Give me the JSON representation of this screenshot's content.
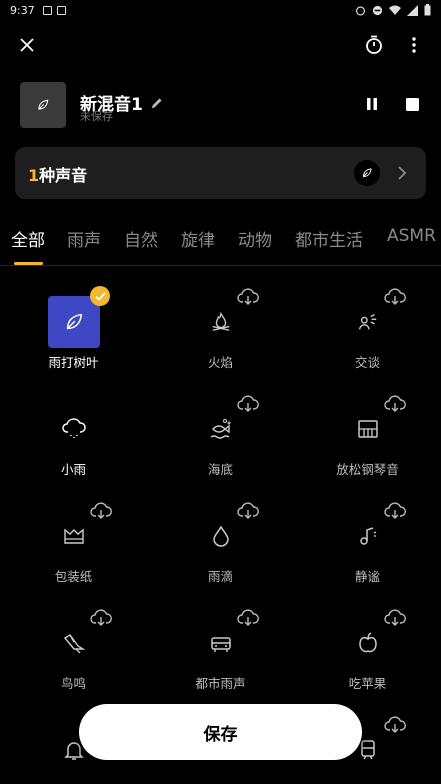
{
  "status_bar": {
    "time": "9:37"
  },
  "mix": {
    "title": "新混音1",
    "subtitle": "未保存"
  },
  "sound_count": {
    "number": "1",
    "suffix": "种声音"
  },
  "tabs": [
    {
      "label": "全部",
      "active": true
    },
    {
      "label": "雨声"
    },
    {
      "label": "自然"
    },
    {
      "label": "旋律"
    },
    {
      "label": "动物"
    },
    {
      "label": "都市生活"
    },
    {
      "label": "ASMR"
    }
  ],
  "sounds": [
    {
      "label": "雨打树叶",
      "icon": "leaf-icon",
      "selected": true
    },
    {
      "label": "火焰",
      "icon": "campfire-icon",
      "download": true
    },
    {
      "label": "交谈",
      "icon": "people-talking-icon",
      "download": true
    },
    {
      "label": "小雨",
      "icon": "rain-cloud-icon"
    },
    {
      "label": "海底",
      "icon": "fish-underwater-icon",
      "download": true
    },
    {
      "label": "放松钢琴音",
      "icon": "piano-icon",
      "download": true
    },
    {
      "label": "包装纸",
      "icon": "wrapping-paper-icon",
      "download": true
    },
    {
      "label": "雨滴",
      "icon": "water-drop-icon",
      "download": true
    },
    {
      "label": "静谧",
      "icon": "music-note-icon",
      "download": true
    },
    {
      "label": "鸟鸣",
      "icon": "bird-icon",
      "download": true
    },
    {
      "label": "都市雨声",
      "icon": "car-icon",
      "download": true
    },
    {
      "label": "吃苹果",
      "icon": "apple-icon",
      "download": true
    },
    {
      "label": "",
      "icon": "bell-icon"
    },
    {
      "label": "",
      "icon": "sound-icon"
    },
    {
      "label": "",
      "icon": "train-icon",
      "download": true
    }
  ],
  "save_label": "保存",
  "colors": {
    "accent": "#f5b72b",
    "selected_tile": "#3f48c4",
    "card": "#1e1e1e"
  }
}
